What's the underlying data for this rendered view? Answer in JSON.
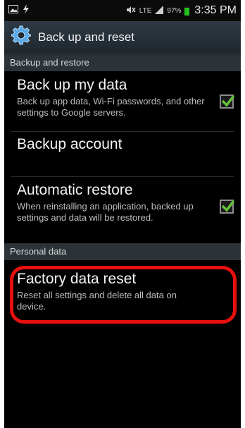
{
  "status_bar": {
    "icons": [
      "gallery-icon",
      "usb-icon",
      "mute-icon",
      "lte-icon",
      "signal-icon"
    ],
    "network": "LTE",
    "battery_percent": "97%",
    "time": "3:35 PM"
  },
  "header": {
    "icon": "gear-icon",
    "title": "Back up and reset"
  },
  "sections": {
    "backup": {
      "label": "Backup and restore"
    },
    "personal": {
      "label": "Personal data"
    }
  },
  "items": {
    "backup_data": {
      "title": "Back up my data",
      "summary": "Back up app data, Wi-Fi passwords, and other settings to Google servers.",
      "checked": true
    },
    "backup_account": {
      "title": "Backup account"
    },
    "auto_restore": {
      "title": "Automatic restore",
      "summary": "When reinstalling an application, backed up settings and data will be restored.",
      "checked": true
    },
    "factory_reset": {
      "title": "Factory data reset",
      "summary": "Reset all settings and delete all data on device."
    }
  },
  "colors": {
    "check": "#63c23a",
    "highlight": "#e8100e",
    "battery": "#26c21e"
  }
}
